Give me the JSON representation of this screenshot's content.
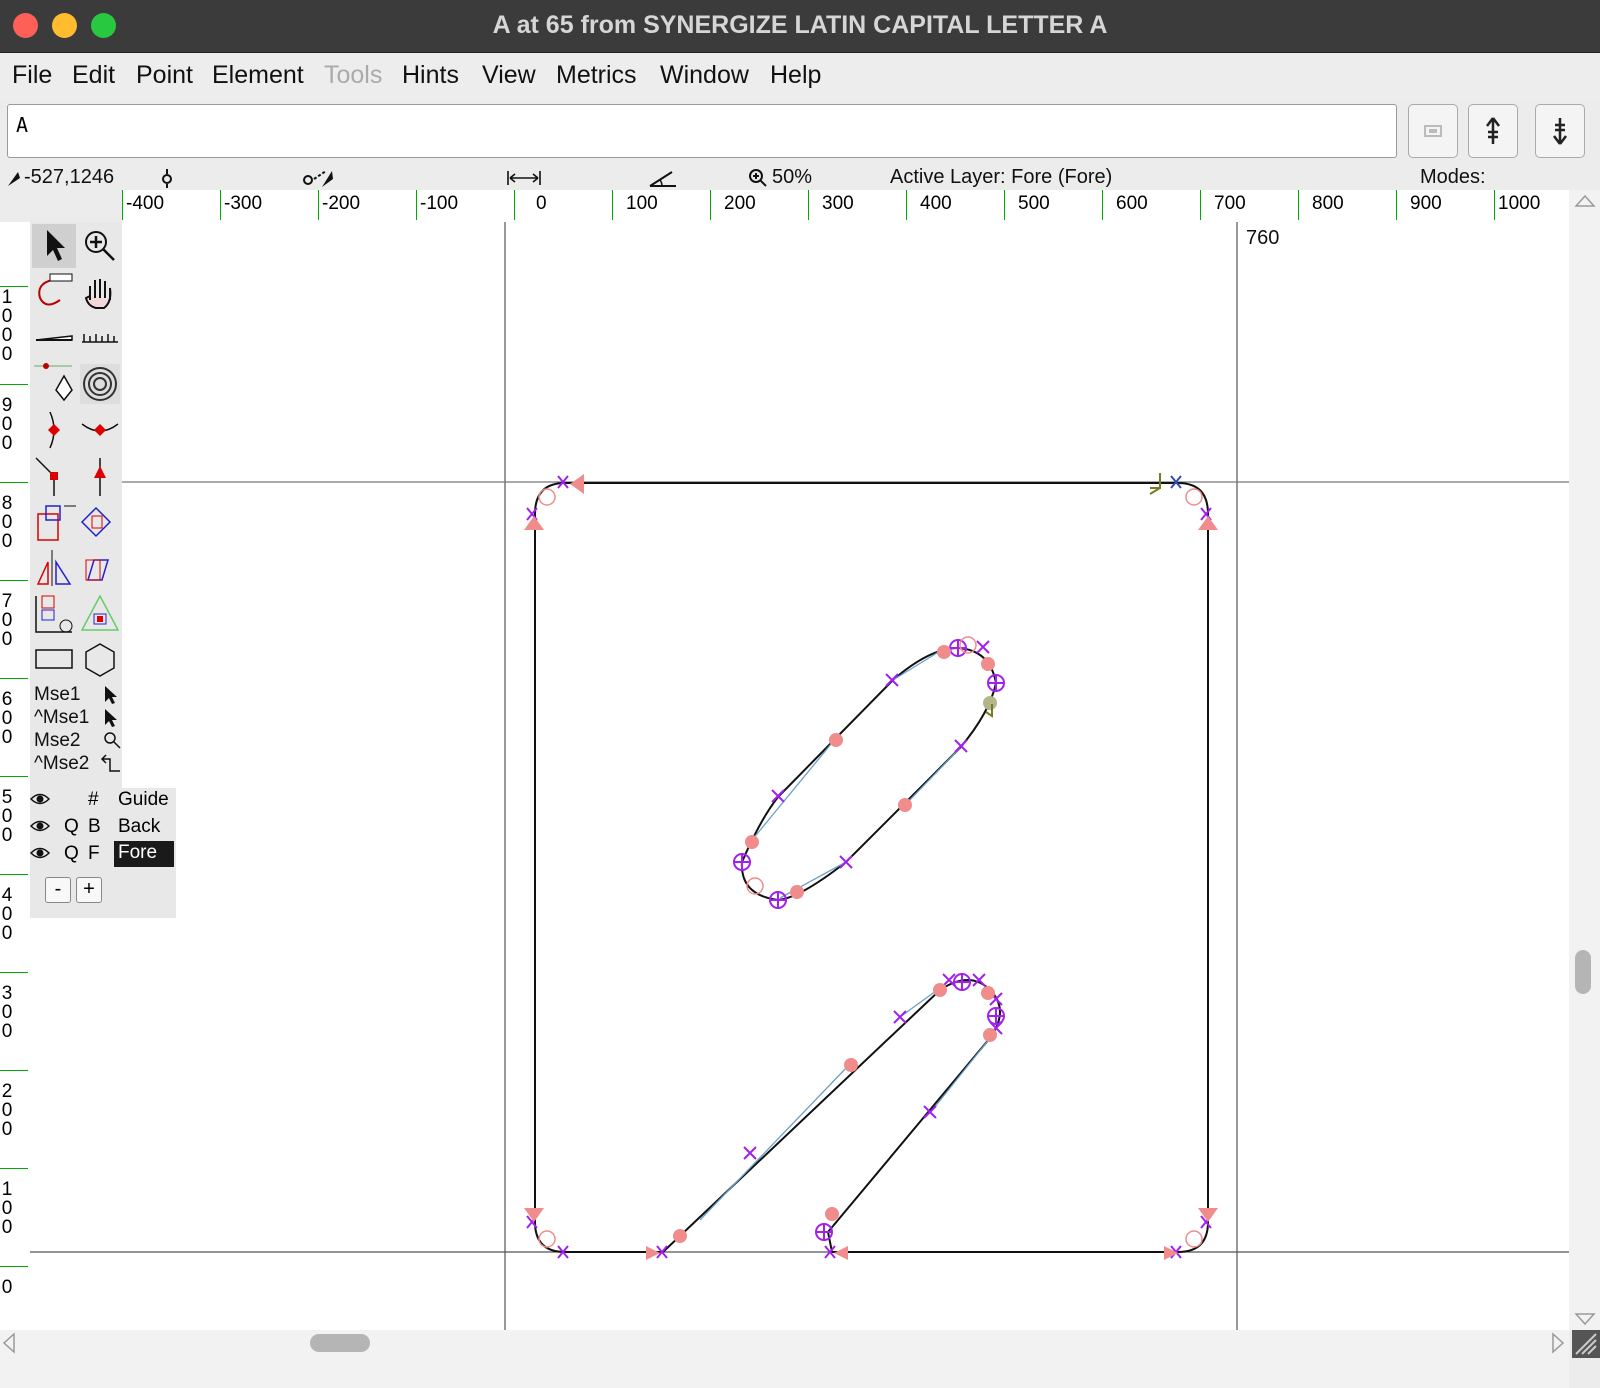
{
  "window": {
    "title": "A at 65 from SYNERGIZE LATIN CAPITAL LETTER A"
  },
  "menu": {
    "file": "File",
    "edit": "Edit",
    "point": "Point",
    "element": "Element",
    "tools": "Tools",
    "hints": "Hints",
    "view": "View",
    "metrics": "Metrics",
    "window": "Window",
    "help": "Help"
  },
  "char_field": {
    "value": "A"
  },
  "status": {
    "coords": "-527,1246",
    "zoom": "50%",
    "active_layer": "Active Layer: Fore (Fore)",
    "modes": "Modes:"
  },
  "ruler": {
    "h_labels": [
      "-400",
      "-300",
      "-200",
      "-100",
      "0",
      "100",
      "200",
      "300",
      "400",
      "500",
      "600",
      "700",
      "800",
      "900",
      "1000"
    ],
    "v_labels": [
      "1000",
      "900",
      "800",
      "700",
      "600",
      "500",
      "400",
      "300",
      "200",
      "100",
      "0"
    ]
  },
  "canvas": {
    "advance_width_label": "760"
  },
  "mouse_hints": {
    "mse1": "Mse1",
    "ctrl_mse1": "^Mse1",
    "mse2": "Mse2",
    "ctrl_mse2": "^Mse2"
  },
  "layers": [
    {
      "q": "",
      "code": "#",
      "name": "Guide",
      "selected": false
    },
    {
      "q": "Q",
      "code": "B",
      "name": "Back",
      "selected": false
    },
    {
      "q": "Q",
      "code": "F",
      "name": "Fore",
      "selected": true
    }
  ],
  "layer_buttons": {
    "remove": "-",
    "add": "+"
  },
  "colors": {
    "accent": "#a020f0",
    "point_fill": "#f08080",
    "selection_bg": "#1a1a1a"
  }
}
